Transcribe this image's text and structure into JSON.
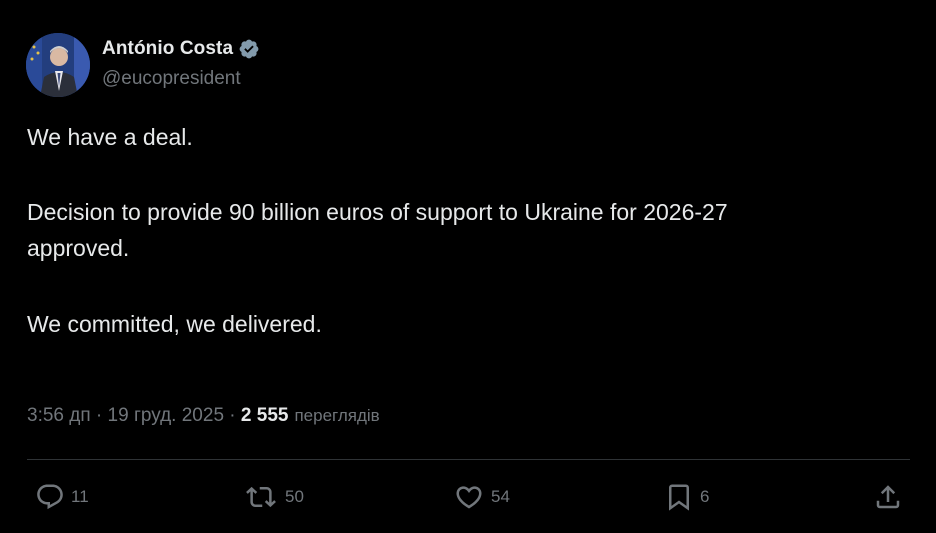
{
  "author": {
    "display_name": "António Costa",
    "handle": "@eucopresident",
    "verified": true
  },
  "tweet": {
    "line1": "We have a deal.",
    "line2": "Decision to provide 90 billion euros of support to Ukraine for 2026-27",
    "line3": "approved.",
    "line4": "We committed, we delivered."
  },
  "meta": {
    "time": "3:56 дп",
    "separator1": " · ",
    "date": "19 груд. 2025",
    "separator2": " · ",
    "views_count": "2 555",
    "views_label": "переглядів"
  },
  "actions": {
    "reply_count": "11",
    "retweet_count": "50",
    "like_count": "54",
    "bookmark_count": "6"
  },
  "icons": {
    "reply": "reply-icon",
    "retweet": "retweet-icon",
    "like": "heart-icon",
    "bookmark": "bookmark-icon",
    "share": "share-icon",
    "verified": "verified-badge-icon"
  },
  "colors": {
    "background": "#000000",
    "text_primary": "#e7e9ea",
    "text_secondary": "#71767b",
    "divider": "#2f3336"
  }
}
